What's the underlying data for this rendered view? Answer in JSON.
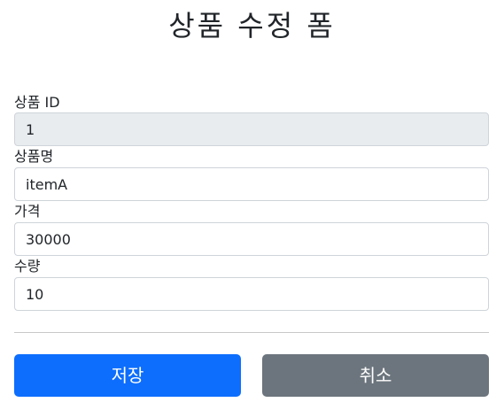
{
  "form": {
    "title": "상품 수정 폼",
    "fields": [
      {
        "label": "상품 ID",
        "value": "1"
      },
      {
        "label": "상품명",
        "value": "itemA"
      },
      {
        "label": "가격",
        "value": "30000"
      },
      {
        "label": "수량",
        "value": "10"
      }
    ],
    "buttons": {
      "save_label": "저장",
      "cancel_label": "취소"
    }
  },
  "colors": {
    "primary": "#0d6efd",
    "secondary": "#6c757d",
    "readonly_bg": "#e9ecef",
    "input_border": "#ced4da"
  }
}
